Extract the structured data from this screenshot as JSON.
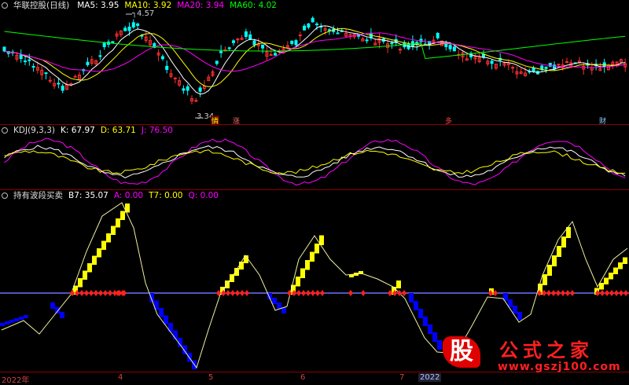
{
  "main_panel": {
    "stock_title": "华联控股(日线)",
    "ma": [
      {
        "label": "MA5: 3.95",
        "color": "#ffffff"
      },
      {
        "label": "MA10: 3.92",
        "color": "#ffff00"
      },
      {
        "label": "MA20: 3.94",
        "color": "#ff00ff"
      },
      {
        "label": "MA60: 4.02",
        "color": "#00ff00"
      }
    ],
    "high_label": "4.57",
    "low_label": "3.34",
    "event_marks": [
      "憐",
      "涨",
      "多",
      "财"
    ]
  },
  "kdj_panel": {
    "title": "KDJ(9,3,3)",
    "k": "K: 67.97",
    "d": "D: 63.71",
    "j": "J: 76.50"
  },
  "band_panel": {
    "title": "持有波段买卖",
    "b7": "B7: 35.07",
    "a": "A: 0.00",
    "t7": "T7: 0.00",
    "q": "Q: 0.00"
  },
  "x_axis": {
    "labels": [
      "2022年",
      "4",
      "5",
      "6",
      "7",
      "2022"
    ]
  },
  "watermark": {
    "badge": "股",
    "title": "公式之家",
    "url": "www.gszj100.com"
  },
  "colors": {
    "separator": "#8b0000",
    "up": "#ff3030",
    "down": "#00ffff",
    "ma5": "#ffffff",
    "ma10": "#ffff00",
    "ma20": "#ff00ff",
    "ma60": "#00ff00",
    "buy_block": "#ffff00",
    "sell_block": "#0000ff",
    "baseline": "#7070ff"
  }
}
